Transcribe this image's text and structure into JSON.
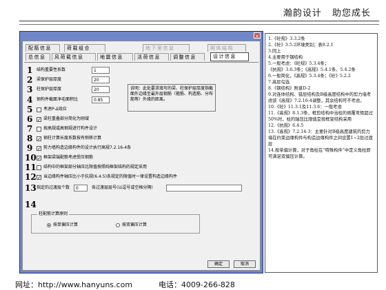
{
  "header": {
    "brand": "瀚韵设计",
    "slogan": "助您成长"
  },
  "dialog": {
    "close_label": "×",
    "tabs": [
      {
        "label": "配筋信息"
      },
      {
        "label": "荷载组合"
      },
      {
        "label": "地下室信息"
      },
      {
        "label": "砌体结构"
      },
      {
        "label": "总信息"
      },
      {
        "label": "风荷载信息"
      },
      {
        "label": "地震信息"
      },
      {
        "label": "活荷信息"
      },
      {
        "label": "调整信息"
      },
      {
        "label": "设计信息"
      }
    ],
    "items": [
      {
        "num": "1",
        "label": "结构重要性系数",
        "value": "1"
      },
      {
        "num": "2",
        "label": "梁保护层厚度",
        "value": "20"
      },
      {
        "num": "3",
        "label": "柱保护层厚度",
        "value": "20"
      },
      {
        "num": "4",
        "label": "钢构件截面净毛面积比",
        "value": "0.85"
      },
      {
        "num": "5",
        "label": "考虑P-Δ效应",
        "checked": false
      },
      {
        "num": "6",
        "label": "梁柱重叠部分简化为刚域",
        "checked": true
      },
      {
        "num": "7",
        "label": "按高规或高钢规进行构件设计",
        "checked": false
      },
      {
        "num": "8",
        "label": "钢柱计算长度系数按有侧移计算",
        "checked": true
      },
      {
        "num": "9",
        "label": "剪力墙构造边缘构件的设计执行高规7.2.16-4条",
        "checked": true
      },
      {
        "num": "10",
        "label": "框架梁端配筋考虑受压钢筋",
        "checked": true
      },
      {
        "num": "11",
        "label": "结构中的框架部分轴压比限值按照纯框架结构的规定采用",
        "checked": false
      },
      {
        "num": "12",
        "label": "当边缘构件轴压比小于抗规(6.4.5)条规定的限值时一律设置构造边缘构件",
        "checked": true
      },
      {
        "num": "13",
        "label": "指定的过渡层个数",
        "value": "0",
        "label2": "各过渡层层号(以逗号或空格分隔)",
        "value2": ""
      },
      {
        "num": "14",
        "label": "柱配筋计算原则"
      }
    ],
    "note_text": "说明：此处要求填写的梁、柱保护层厚度指截面外边缘至最外层钢筋（箍筋、构造筋、分布筋等）外缘的距离。",
    "radio_options": [
      {
        "label": "按单偏压计算",
        "selected": true
      },
      {
        "label": "按双偏压计算",
        "selected": false
      }
    ],
    "ok_label": "确定",
    "cancel_label": "取消"
  },
  "notes": [
    "1.《砼规》3.3.2条",
    "2.《砼》3.5.2环境类别；表8.2.1",
    "3.同上",
    "4.主要用于钢结构",
    "5.一般考虑：《砼规》5.3.4条；",
    "《抗规》3.6.3条；《高规》5.4.1条、5.4.2条",
    "6.一般简化，《高规》5.3.4条；《砼》5.2.2",
    "7.高层勾选",
    "8.《钢结构》附录D-2",
    "9.对连体结构、错层结构及B级高度结构中的剪力墙考虑该《高规》7.2.16-4调整，其余结构可不考虑。",
    "10.《砼》11.3.1及11.3.6：一般考虑",
    "11.《高规》8.1.3条，框剪结构中当柱的倾覆弯矩超过50%时，柱的轴压比限值宜按框架结构采用",
    "12.《抗规》6.4.5",
    "13.《高规》7.2.14-3：主要针对B级高度建筑的剪力墙在约束边缘构件与构造边缘构件之间设置1~2层过渡层",
    "14.按单偏计算，对于角柱在“特殊构件”中定义角柱即可满足双偏压计算。"
  ],
  "footer": {
    "website": "网址：http://www.hanyuns.com",
    "phone": "电话：4009-266-828"
  }
}
